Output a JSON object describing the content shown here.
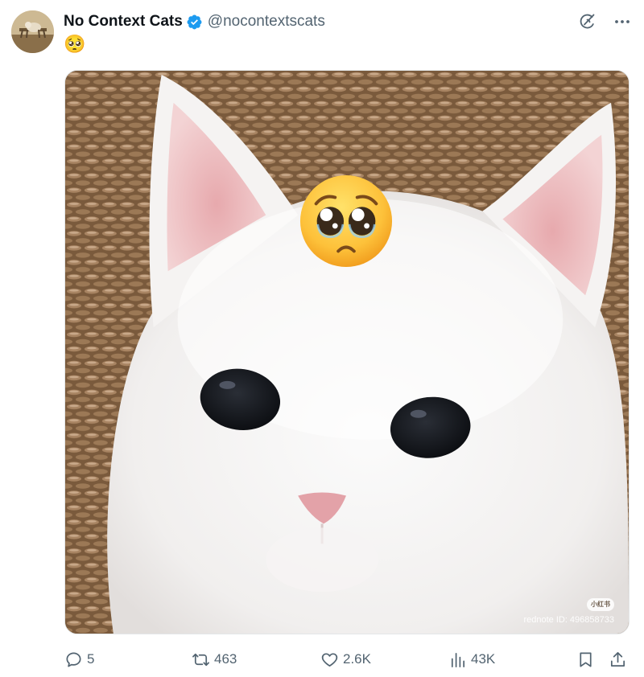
{
  "author": {
    "display_name": "No Context Cats",
    "handle": "@nocontextscats",
    "verified": true,
    "verified_color": "#1d9bf0"
  },
  "tweet": {
    "text": "🥺"
  },
  "media": {
    "overlay_emoji": "pleading-face",
    "watermark_logo": "小红书",
    "watermark_text": "rednote ID: 496858733"
  },
  "actions": {
    "replies": "5",
    "reposts": "463",
    "likes": "2.6K",
    "views": "43K"
  },
  "icons": {
    "reply": "reply-icon",
    "repost": "repost-icon",
    "like": "heart-icon",
    "views": "views-icon",
    "bookmark": "bookmark-icon",
    "share": "share-icon",
    "grok": "grok-icon",
    "more": "more-icon"
  },
  "colors": {
    "text_primary": "#0f1419",
    "text_secondary": "#536471"
  }
}
